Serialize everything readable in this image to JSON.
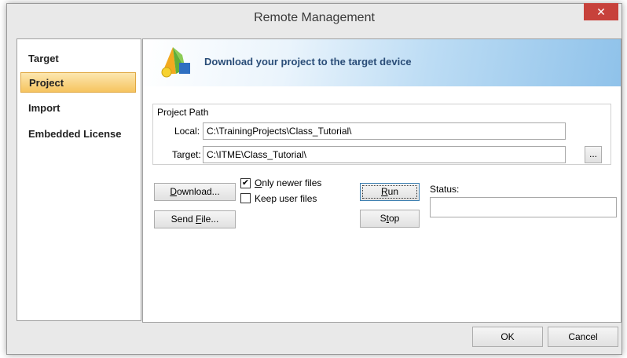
{
  "window": {
    "title": "Remote Management",
    "close_label": "✕"
  },
  "sidebar": {
    "items": [
      {
        "label": "Target"
      },
      {
        "label": "Project"
      },
      {
        "label": "Import"
      },
      {
        "label": "Embedded License"
      }
    ]
  },
  "banner": {
    "text": "Download your project to the target device",
    "icon": "project-pyramid-icon"
  },
  "project_path": {
    "legend": "Project Path",
    "local_label": "Local:",
    "local_value": "C:\\TrainingProjects\\Class_Tutorial\\",
    "target_label": "Target:",
    "target_value": "C:\\ITME\\Class_Tutorial\\",
    "browse_label": "..."
  },
  "actions": {
    "download_label_u": "D",
    "download_label_rest": "ownload...",
    "sendfile_label_pre": "Send ",
    "sendfile_label_u": "F",
    "sendfile_label_rest": "ile...",
    "only_newer_u": "O",
    "only_newer_rest": "nly newer files",
    "only_newer_checked": "✔",
    "keep_user_files": "Keep user files",
    "run_u": "R",
    "run_rest": "un",
    "stop_pre": "S",
    "stop_u": "t",
    "stop_rest": "op",
    "status_label": "Status:"
  },
  "footer": {
    "ok_label": "OK",
    "cancel_label": "Cancel"
  }
}
